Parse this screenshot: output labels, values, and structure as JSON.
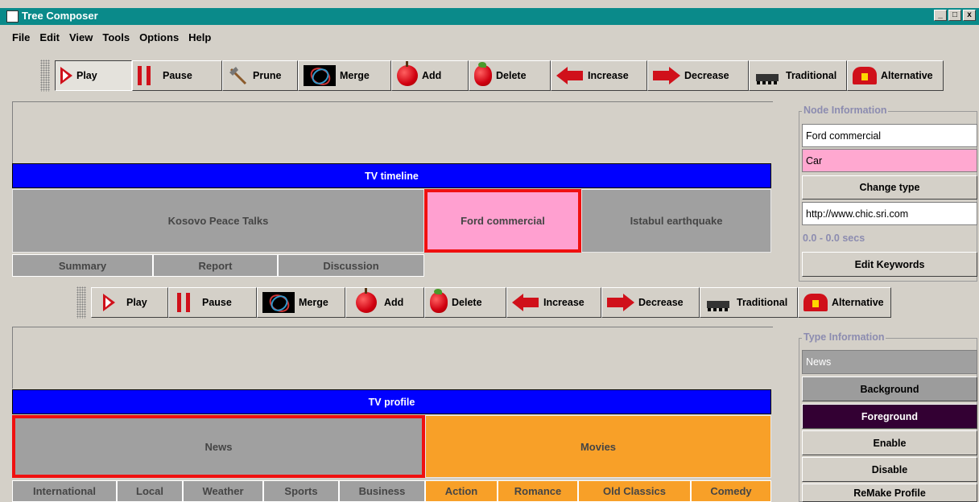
{
  "window": {
    "title": "Tree Composer",
    "controls": [
      "_",
      "□",
      "x"
    ]
  },
  "menu": [
    "File",
    "Edit",
    "View",
    "Tools",
    "Options",
    "Help"
  ],
  "toolbar1": [
    {
      "label": "Play",
      "icon": "play-icon"
    },
    {
      "label": "Pause",
      "icon": "pause-icon"
    },
    {
      "label": "Prune",
      "icon": "axe-icon"
    },
    {
      "label": "Merge",
      "icon": "merge-icon"
    },
    {
      "label": "Add",
      "icon": "apple-icon"
    },
    {
      "label": "Delete",
      "icon": "bitten-apple-icon"
    },
    {
      "label": "Increase",
      "icon": "arrow-left-icon"
    },
    {
      "label": "Decrease",
      "icon": "arrow-right-icon"
    },
    {
      "label": "Traditional",
      "icon": "steam-train-icon"
    },
    {
      "label": "Alternative",
      "icon": "modern-train-icon"
    }
  ],
  "toolbar2": [
    {
      "label": "Play",
      "icon": "play-icon"
    },
    {
      "label": "Pause",
      "icon": "pause-icon"
    },
    {
      "label": "Merge",
      "icon": "merge-icon"
    },
    {
      "label": "Add",
      "icon": "apple-icon"
    },
    {
      "label": "Delete",
      "icon": "bitten-apple-icon"
    },
    {
      "label": "Increase",
      "icon": "arrow-left-icon"
    },
    {
      "label": "Decrease",
      "icon": "arrow-right-icon"
    },
    {
      "label": "Traditional",
      "icon": "steam-train-icon"
    },
    {
      "label": "Alternative",
      "icon": "modern-train-icon"
    }
  ],
  "timeline": {
    "title": "TV timeline",
    "segments": [
      "Kosovo Peace Talks",
      "Ford commercial",
      "Istabul earthquake"
    ],
    "subsegments": [
      "Summary",
      "Report",
      "Discussion"
    ]
  },
  "profile": {
    "title": "TV profile",
    "categories": [
      "News",
      "Movies"
    ],
    "news_children": [
      "International",
      "Local",
      "Weather",
      "Sports",
      "Business"
    ],
    "movies_children": [
      "Action",
      "Romance",
      "Old Classics",
      "Comedy"
    ]
  },
  "node_info": {
    "title": "Node Information",
    "name": "Ford commercial",
    "type": "Car",
    "change_type": "Change type",
    "url": "http://www.chic.sri.com",
    "time": "0.0 - 0.0 secs",
    "edit_keywords": "Edit Keywords"
  },
  "type_info": {
    "title": "Type Information",
    "type": "News",
    "background": "Background",
    "foreground": "Foreground",
    "enable": "Enable",
    "disable": "Disable",
    "remake": "ReMake Profile"
  },
  "colors": {
    "titlebar": "#0a8a8a",
    "selection": "#f01010",
    "blue_header": "#0000ff",
    "commercial": "#ffa0d0",
    "movies": "#f8a028",
    "foreground": "#330033"
  }
}
